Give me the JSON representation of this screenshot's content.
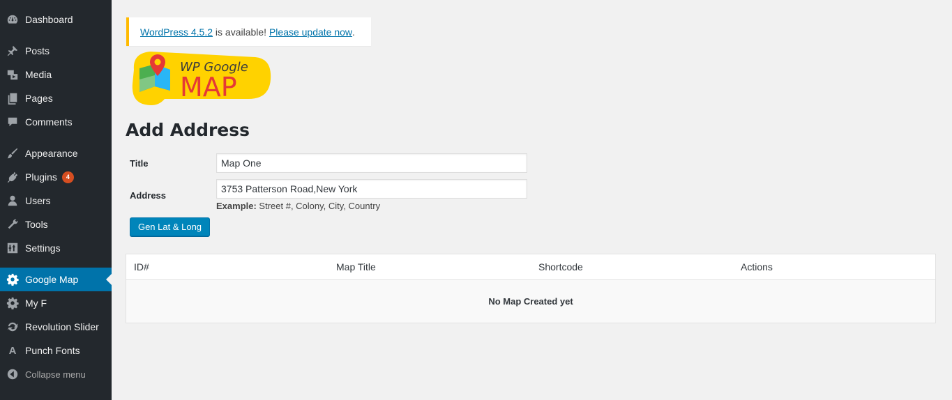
{
  "sidebar": {
    "items": [
      {
        "label": "Dashboard",
        "icon": "dashboard-icon"
      },
      {
        "label": "Posts",
        "icon": "pin-icon"
      },
      {
        "label": "Media",
        "icon": "media-icon"
      },
      {
        "label": "Pages",
        "icon": "pages-icon"
      },
      {
        "label": "Comments",
        "icon": "comment-icon"
      },
      {
        "label": "Appearance",
        "icon": "brush-icon"
      },
      {
        "label": "Plugins",
        "icon": "plug-icon",
        "badge": "4"
      },
      {
        "label": "Users",
        "icon": "user-icon"
      },
      {
        "label": "Tools",
        "icon": "wrench-icon"
      },
      {
        "label": "Settings",
        "icon": "settings-icon"
      },
      {
        "label": "Google Map",
        "icon": "gear-icon",
        "current": true
      },
      {
        "label": "My F",
        "icon": "gear-icon"
      },
      {
        "label": "Revolution Slider",
        "icon": "refresh-icon"
      },
      {
        "label": "Punch Fonts",
        "icon": "font-icon"
      }
    ],
    "collapse_label": "Collapse menu"
  },
  "notice": {
    "link1": "WordPress 4.5.2",
    "text": " is available! ",
    "link2": "Please update now",
    "end": ".",
    "accent": "#ffba00"
  },
  "logo": {
    "line1": "WP Google",
    "line2": "MAP"
  },
  "page": {
    "title": "Add Address"
  },
  "form": {
    "title_label": "Title",
    "title_value": "Map One",
    "address_label": "Address",
    "address_value": "3753 Patterson Road,New York",
    "example_bold": "Example:",
    "example_text": " Street #, Colony, City, Country",
    "button_label": "Gen Lat & Long"
  },
  "table": {
    "headers": [
      "ID#",
      "Map Title",
      "Shortcode",
      "Actions"
    ],
    "empty_message": "No Map Created yet"
  },
  "colors": {
    "sidebar_bg": "#23282d",
    "current_bg": "#0073aa",
    "button_bg": "#0085ba",
    "badge_bg": "#d54e21"
  }
}
